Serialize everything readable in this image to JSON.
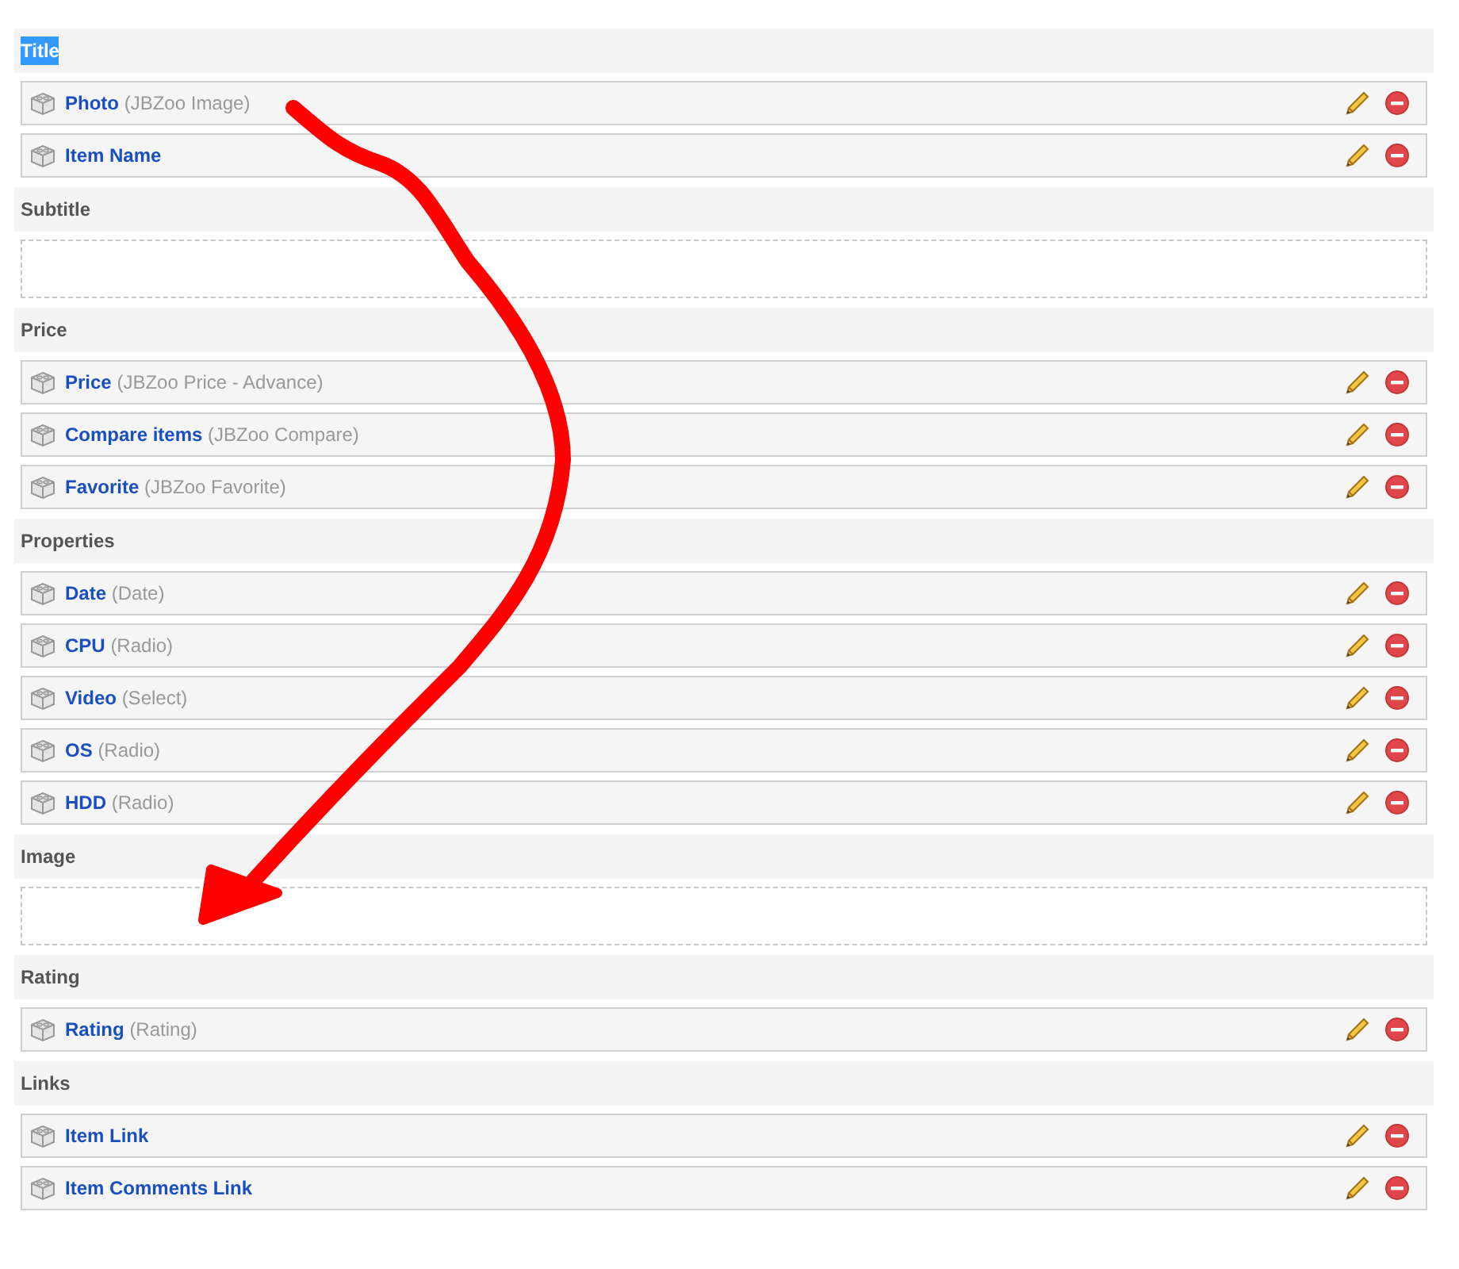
{
  "sections": [
    {
      "title": "Title",
      "selected": true,
      "items": [
        {
          "name": "Photo",
          "type": "(JBZoo Image)"
        },
        {
          "name": "Item Name"
        }
      ]
    },
    {
      "title": "Subtitle",
      "selected": false
    },
    {
      "title": "Price",
      "selected": false,
      "items": [
        {
          "name": "Price",
          "type": "(JBZoo Price - Advance)"
        },
        {
          "name": "Compare items",
          "type": "(JBZoo Compare)"
        },
        {
          "name": "Favorite",
          "type": "(JBZoo Favorite)"
        }
      ]
    },
    {
      "title": "Properties",
      "selected": false,
      "items": [
        {
          "name": "Date",
          "type": "(Date)"
        },
        {
          "name": "CPU",
          "type": "(Radio)"
        },
        {
          "name": "Video",
          "type": "(Select)"
        },
        {
          "name": "OS",
          "type": "(Radio)"
        },
        {
          "name": "HDD",
          "type": "(Radio)"
        }
      ]
    },
    {
      "title": "Image",
      "selected": false
    },
    {
      "title": "Rating",
      "selected": false,
      "items": [
        {
          "name": "Rating",
          "type": "(Rating)"
        }
      ]
    },
    {
      "title": "Links",
      "selected": false,
      "items": [
        {
          "name": "Item Link"
        },
        {
          "name": "Item Comments Link"
        }
      ]
    }
  ]
}
